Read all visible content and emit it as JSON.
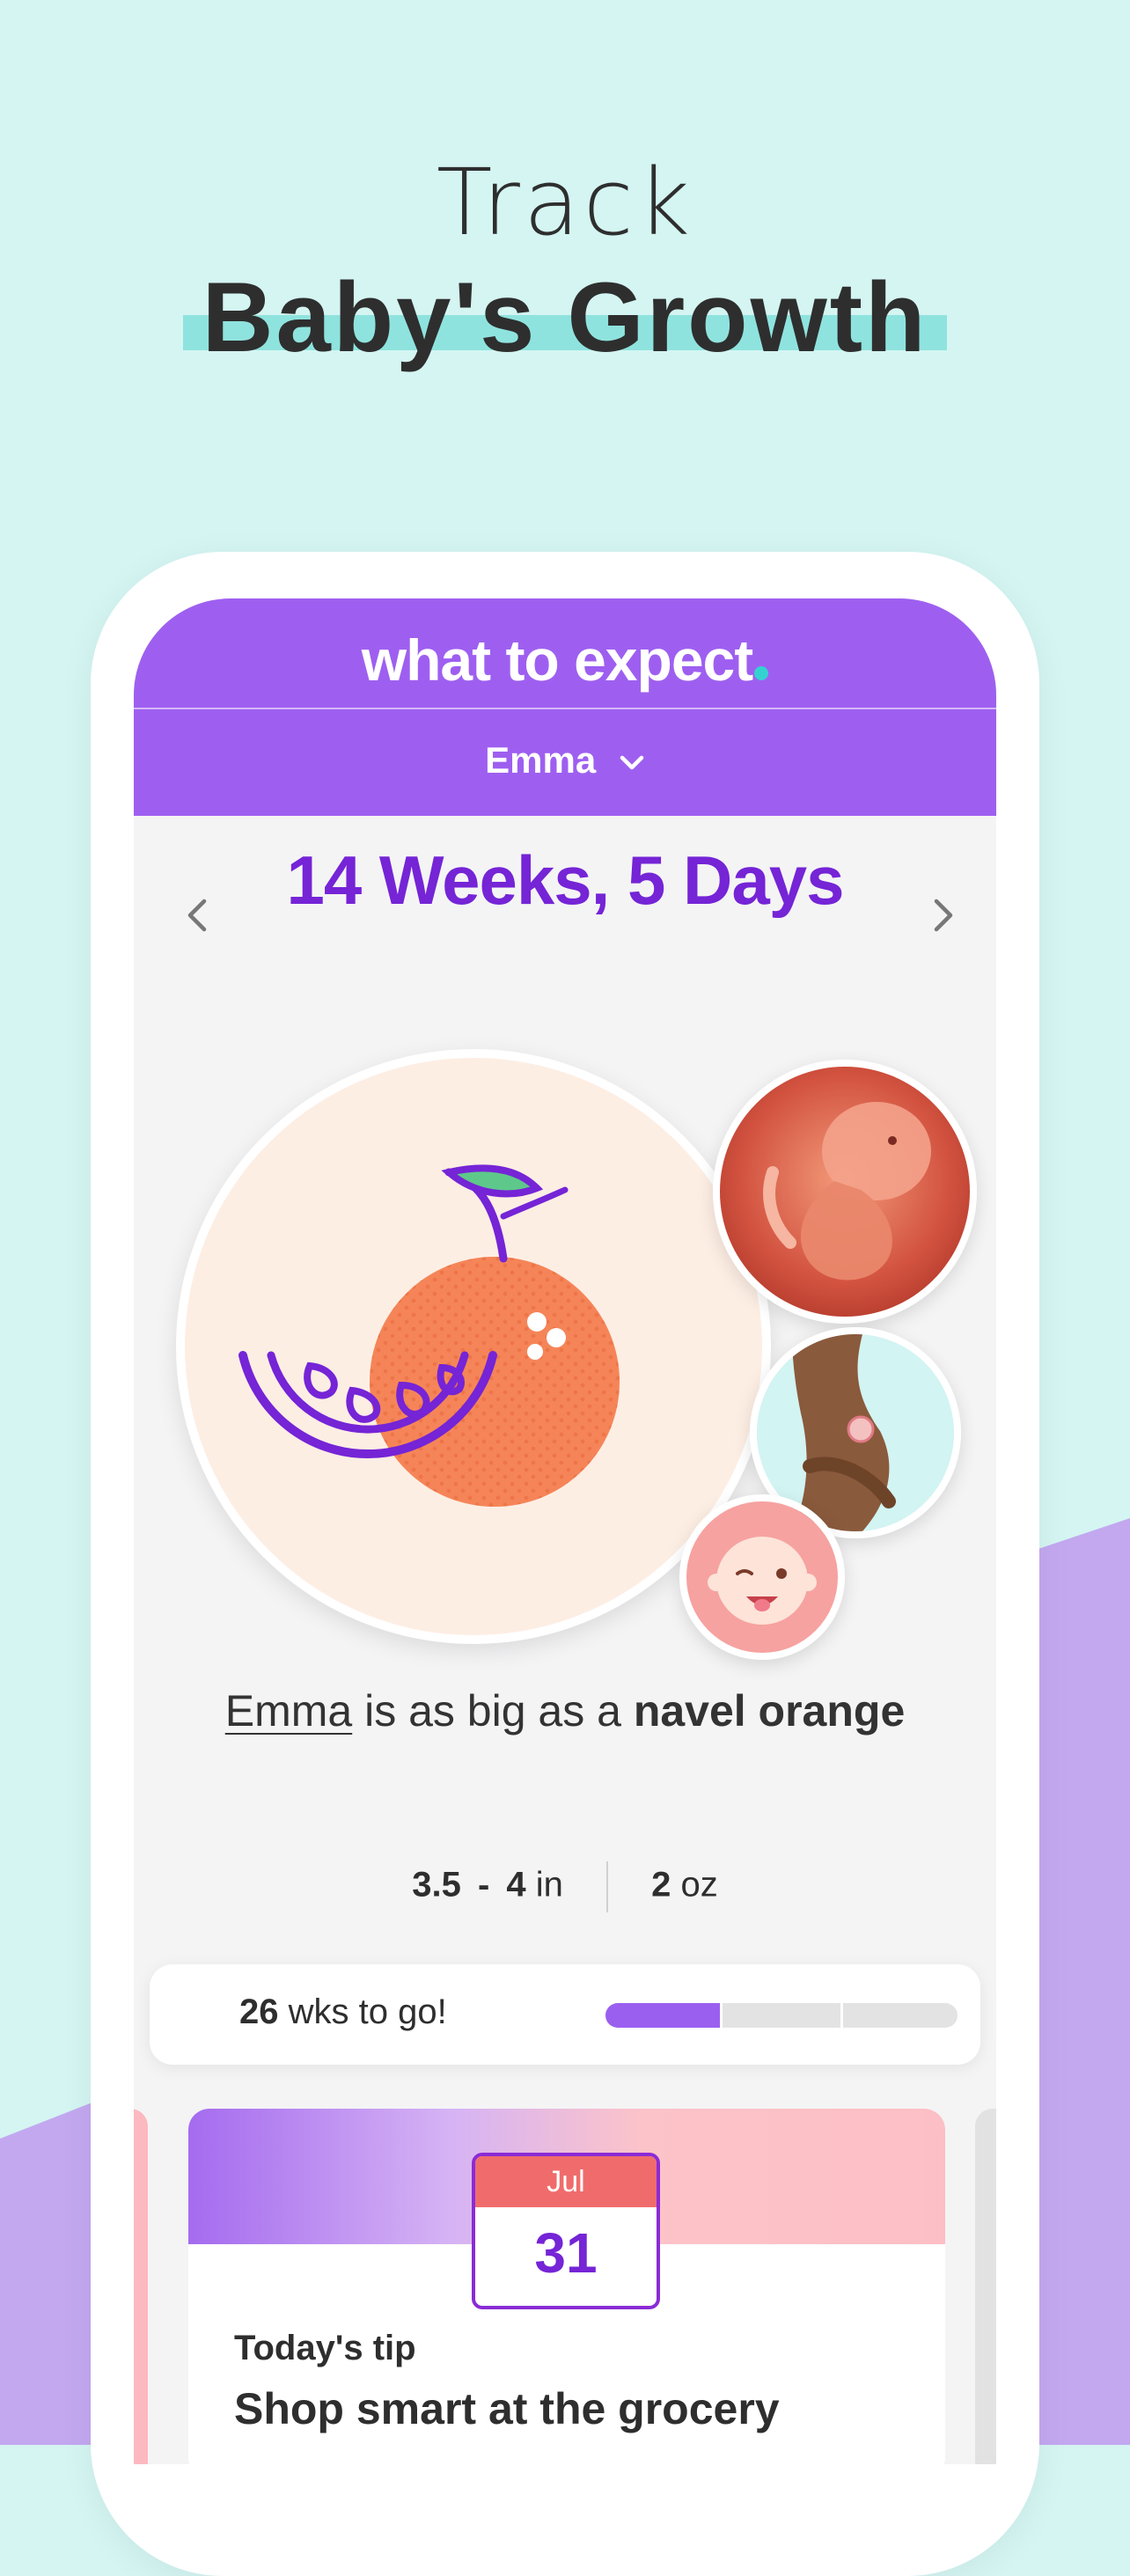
{
  "headline": {
    "line1": "Track",
    "line2": "Baby's Growth"
  },
  "app": {
    "logo": "what to expect",
    "profile_name": "Emma",
    "week_label": "14 Weeks, 5 Days"
  },
  "comparison": {
    "name": "Emma",
    "middle": " is as big as a ",
    "fruit": "navel orange"
  },
  "size": {
    "length_min": "3.5",
    "dash": "-",
    "length_max": "4",
    "length_unit": "in",
    "weight": "2",
    "weight_unit": "oz"
  },
  "progress": {
    "weeks_left": "26",
    "suffix": "wks to go!",
    "fraction": 0.33
  },
  "tip": {
    "month": "Jul",
    "day": "31",
    "label": "Today's tip",
    "title": "Shop smart at the grocery"
  },
  "colors": {
    "brand_purple": "#9e5ff0",
    "title_purple": "#7524d6",
    "mint": "#d4f5f2",
    "orange": "#f58558"
  },
  "icons": [
    "chevron-left-icon",
    "chevron-right-icon",
    "chevron-down-icon",
    "orange-illustration",
    "fetus-image",
    "belly-image",
    "baby-face-icon"
  ]
}
